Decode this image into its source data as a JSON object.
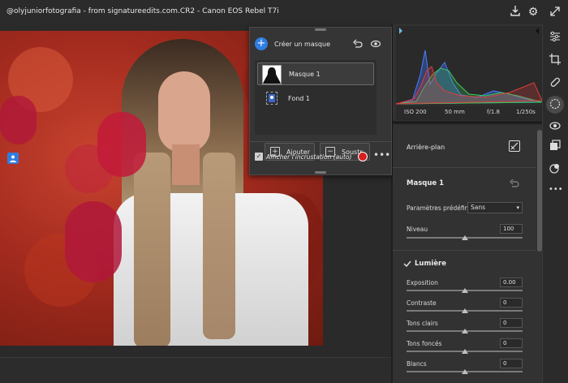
{
  "title": "@olyjuniorfotografia  - from signatureedits.com.CR2  -  Canon EOS Rebel T7i",
  "titlebar_icons": [
    "export-icon",
    "gear-icon"
  ],
  "mask_panel": {
    "create_label": "Créer un masque",
    "masks": [
      {
        "name": "Masque 1",
        "selected": true
      },
      {
        "name": "Fond 1",
        "selected": false
      }
    ],
    "add_label": "Ajouter",
    "subtract_label": "Soustr.",
    "overlay_label": "Afficher l'incrustation (auto)",
    "overlay_checked": true,
    "overlay_color": "#d81e1e"
  },
  "histogram": {
    "iso": "ISO 200",
    "focal": "50 mm",
    "aperture": "f/1.8",
    "shutter": "1/250s"
  },
  "right_panel": {
    "background_label": "Arrière-plan",
    "mask_title": "Masque 1",
    "preset_label": "Paramètres prédéfinis",
    "preset_value": "Sans",
    "level_label": "Niveau",
    "level_value": "100",
    "level_fraction": 1.0,
    "light_title": "Lumière",
    "sliders": [
      {
        "label": "Exposition",
        "value": "0.00",
        "fraction": 0.5
      },
      {
        "label": "Contraste",
        "value": "0",
        "fraction": 0.5
      },
      {
        "label": "Tons clairs",
        "value": "0",
        "fraction": 0.5
      },
      {
        "label": "Tons foncés",
        "value": "0",
        "fraction": 0.5
      },
      {
        "label": "Blancs",
        "value": "0",
        "fraction": 0.5
      }
    ]
  },
  "rail_icons": [
    "expand-icon",
    "sliders-icon",
    "crop-icon",
    "healing-icon",
    "masking-icon",
    "redeye-icon",
    "presets-icon",
    "versions-icon",
    "more-icon"
  ],
  "colors": {
    "accent": "#2f7de1",
    "overlay": "#d81e1e"
  }
}
